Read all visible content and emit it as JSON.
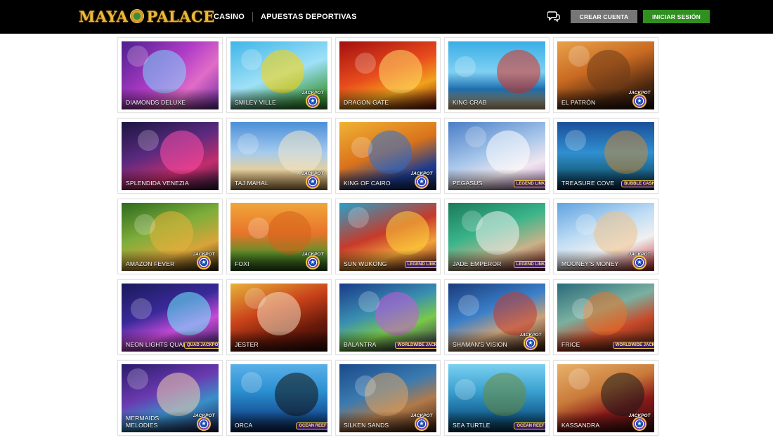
{
  "header": {
    "logo_text_left": "MAYA",
    "logo_text_right": "PALACE",
    "nav": [
      {
        "label": "CASINO"
      },
      {
        "label": "APUESTAS DEPORTIVAS"
      }
    ],
    "chat_icon": "chat-bubbles-icon",
    "create_account_label": "CREAR CUENTA",
    "login_label": "INICIAR SESIÓN"
  },
  "colors": {
    "topbar": "#000000",
    "create_button": "#767676",
    "login_button": "#2f8f1f",
    "logo_gold": "#e7b93b"
  },
  "games": [
    {
      "title": "DIAMONDS DELUXE",
      "badge": "",
      "art_bg": "linear-gradient(135deg,#4d1f8f,#b03cc7 45%,#e06cc7 70%,#6b2aa6)",
      "accent": "#7fd7ff"
    },
    {
      "title": "SMILEY VILLE",
      "badge": "JACKPOT",
      "art_bg": "linear-gradient(160deg,#3fb6e8,#9fe0f7 50%,#3d9a3f 85%)",
      "accent": "#ffd400"
    },
    {
      "title": "DRAGON GATE",
      "badge": "",
      "art_bg": "linear-gradient(160deg,#a31010,#e84b1c 45%,#f2a21c 70%,#6a0d0d)",
      "accent": "#ffd86a"
    },
    {
      "title": "KING CRAB",
      "badge": "",
      "art_bg": "linear-gradient(180deg,#3aaee6,#7fd0f2 45%,#1d6fb0 70%,#e8c98c)",
      "accent": "#e0301e"
    },
    {
      "title": "EL PATRÓN",
      "badge": "JACKPOT",
      "art_bg": "linear-gradient(160deg,#e9a24a,#c96a22 40%,#4a2610 75%,#1b0f08)",
      "accent": "#6b3b17"
    },
    {
      "title": "SPLENDIDA VENEZIA",
      "badge": "",
      "art_bg": "linear-gradient(160deg,#1a1640,#5a2a7f 40%,#c22d6c 70%,#2a1a3a)",
      "accent": "#ff4da6"
    },
    {
      "title": "TAJ MAHAL",
      "badge": "JACKPOT",
      "art_bg": "linear-gradient(180deg,#4a8fd8,#a6cbee 45%,#e3cf9e 70%,#c79a55)",
      "accent": "#f3e7c8"
    },
    {
      "title": "KING OF CAIRO",
      "badge": "JACKPOT",
      "art_bg": "linear-gradient(160deg,#f0b233,#d9731c 45%,#1d3c8f 75%,#0e2456)",
      "accent": "#2c6fd1"
    },
    {
      "title": "PEGASUS",
      "badge": "LEGEND LINK",
      "art_bg": "linear-gradient(160deg,#4b7ec7,#a7c6ea 45%,#f1e6ef 70%,#b88ac9)",
      "accent": "#ffffff"
    },
    {
      "title": "TREASURE COVE",
      "badge": "BUBBLE CASH",
      "art_bg": "linear-gradient(180deg,#1a4f9a,#2f8fcf 45%,#1c6a8f 70%,#0a2c4a)",
      "accent": "#c98a3a"
    },
    {
      "title": "AMAZON FEVER",
      "badge": "JACKPOT",
      "art_bg": "linear-gradient(160deg,#2e6a1f,#7fae3a 40%,#d9a43a 70%,#3a2a10)",
      "accent": "#e8b23a"
    },
    {
      "title": "FOXI",
      "badge": "JACKPOT",
      "art_bg": "linear-gradient(180deg,#f0a63a,#e8742a 45%,#5a8f2a 75%,#2e5a1a)",
      "accent": "#d5621a"
    },
    {
      "title": "SUN WUKONG",
      "badge": "LEGEND LINK",
      "art_bg": "linear-gradient(160deg,#2aa0c9,#c73a2a 45%,#f0a23a 70%,#6a1a1a)",
      "accent": "#ffd23a"
    },
    {
      "title": "JADE EMPEROR",
      "badge": "LEGEND LINK",
      "art_bg": "linear-gradient(160deg,#1a7a5a,#3ab48a 40%,#c9b28a 70%,#7a1a1a)",
      "accent": "#f3f3f3"
    },
    {
      "title": "MOONEY'S MONEY",
      "badge": "JACKPOT",
      "art_bg": "linear-gradient(160deg,#5fa3e0,#bfdcf4 40%,#f0f0f0 65%,#c22a2a)",
      "accent": "#f0c28a"
    },
    {
      "title": "NEON LIGHTS QUAD",
      "badge": "QUAD JACKPOT",
      "art_bg": "linear-gradient(160deg,#1a1a5a,#3a2a9a 40%,#c94ad9 65%,#1a1a4a)",
      "accent": "#6ff0ff"
    },
    {
      "title": "JESTER",
      "badge": "",
      "art_bg": "linear-gradient(160deg,#e8b23a,#c9421a 40%,#6a1a0a 70%,#2a0a05)",
      "accent": "#f3dcc0"
    },
    {
      "title": "BALANTRA",
      "badge": "WORLDWIDE JACKPOT",
      "art_bg": "linear-gradient(160deg,#1a3a8a,#3a8fb0 40%,#7ac94a 65%,#2a1a4a)",
      "accent": "#c95ad9"
    },
    {
      "title": "SHAMAN'S VISION",
      "badge": "JACKPOT",
      "art_bg": "linear-gradient(160deg,#1a3a7a,#3a7fc9 40%,#c9a27a 65%,#3a1a0a)",
      "accent": "#c93a2a"
    },
    {
      "title": "FRICE",
      "badge": "WORLDWIDE JACKPOT",
      "art_bg": "linear-gradient(160deg,#2a6a7a,#7ab0a0 40%,#c94a2a 65%,#3a1a0a)",
      "accent": "#e8742a"
    },
    {
      "title": "MERMAIDS MELODIES",
      "badge": "JACKPOT",
      "art_bg": "linear-gradient(160deg,#2a1a6a,#6a3ab0 40%,#3a8fc9 65%,#1a1a4a)",
      "accent": "#f0d0b0"
    },
    {
      "title": "ORCA",
      "badge": "OCEAN REEF",
      "art_bg": "linear-gradient(180deg,#5ab0e8,#2a8fd0 40%,#1a5aa0 70%,#0a2a5a)",
      "accent": "#101010"
    },
    {
      "title": "SILKEN SANDS",
      "badge": "JACKPOT",
      "art_bg": "linear-gradient(160deg,#1a4a8a,#3a7ab0 40%,#b07a4a 65%,#3a1a0a)",
      "accent": "#d9a46a"
    },
    {
      "title": "SEA TURTLE",
      "badge": "OCEAN REEF",
      "art_bg": "linear-gradient(180deg,#7ad0f0,#3aa0d0 40%,#1a6a9a 70%,#0a3a5a)",
      "accent": "#6a8a3a"
    },
    {
      "title": "KASSANDRA",
      "badge": "JACKPOT",
      "art_bg": "linear-gradient(160deg,#e8b26a,#c97a3a 40%,#8a1a1a 65%,#2a0a0a)",
      "accent": "#1a1a1a"
    }
  ]
}
